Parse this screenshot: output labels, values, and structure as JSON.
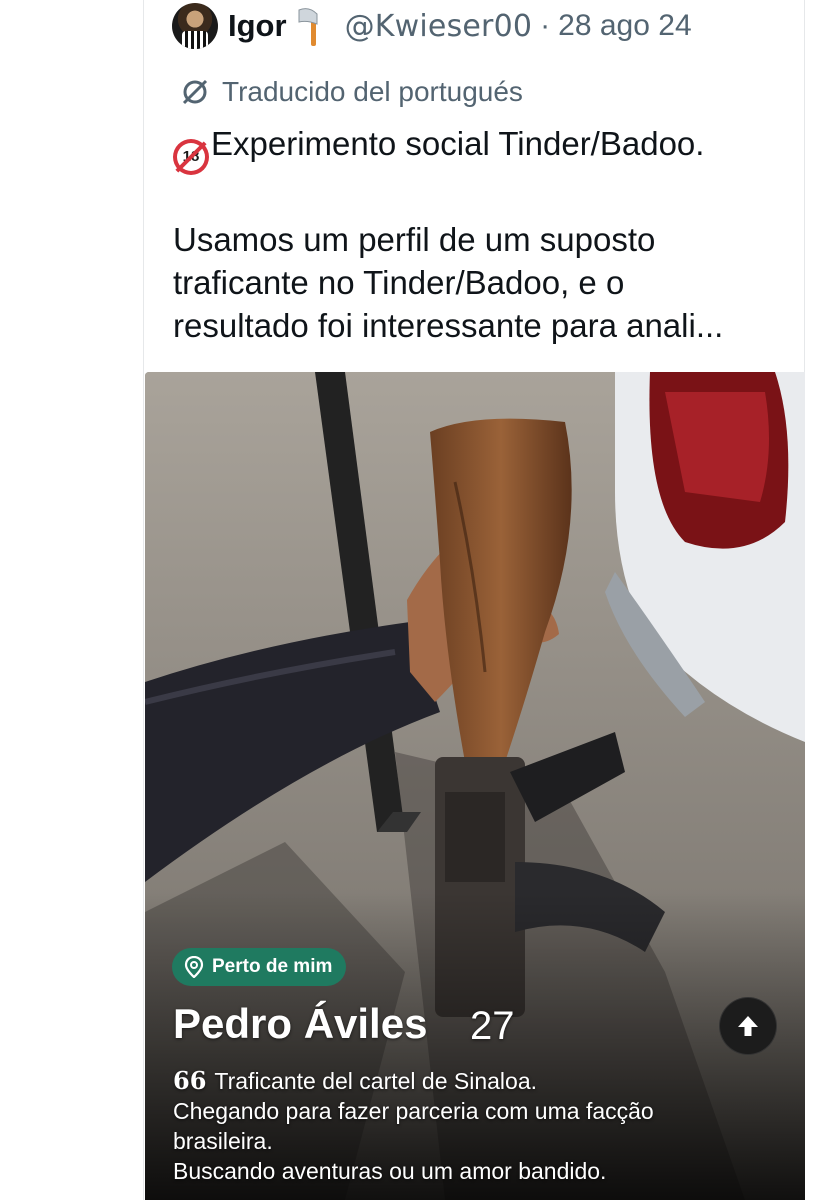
{
  "tweet": {
    "author_name": "Igor",
    "author_handle": "@Kwieser00",
    "separator": "·",
    "date": "28 ago 24",
    "translated_label": "Traducido del portugués",
    "text_lines": [
      "Experimento social Tinder/Badoo.",
      "Usamos um perfil de um suposto",
      "traficante no Tinder/Badoo, e o",
      "resultado foi interessante para anali..."
    ],
    "emoji_badge": "18",
    "emoji_names": [
      "axe-emoji",
      "no-one-under-eighteen-emoji"
    ]
  },
  "profile_card": {
    "location_badge": "Perto de mim",
    "name": "Pedro Áviles",
    "age": "27",
    "bio_lines": [
      "Traficante del cartel de Sinaloa.",
      "Chegando para fazer parceria com uma facção",
      "brasileira.",
      "Buscando aventuras ou um amor bandido."
    ],
    "quote_mark": "66",
    "icons": [
      "location-pin-icon",
      "arrow-up-icon"
    ]
  },
  "colors": {
    "text_primary": "#0f1419",
    "text_secondary": "#536471",
    "badge_green": "#1f7a60",
    "badge_red": "#d9343f"
  }
}
